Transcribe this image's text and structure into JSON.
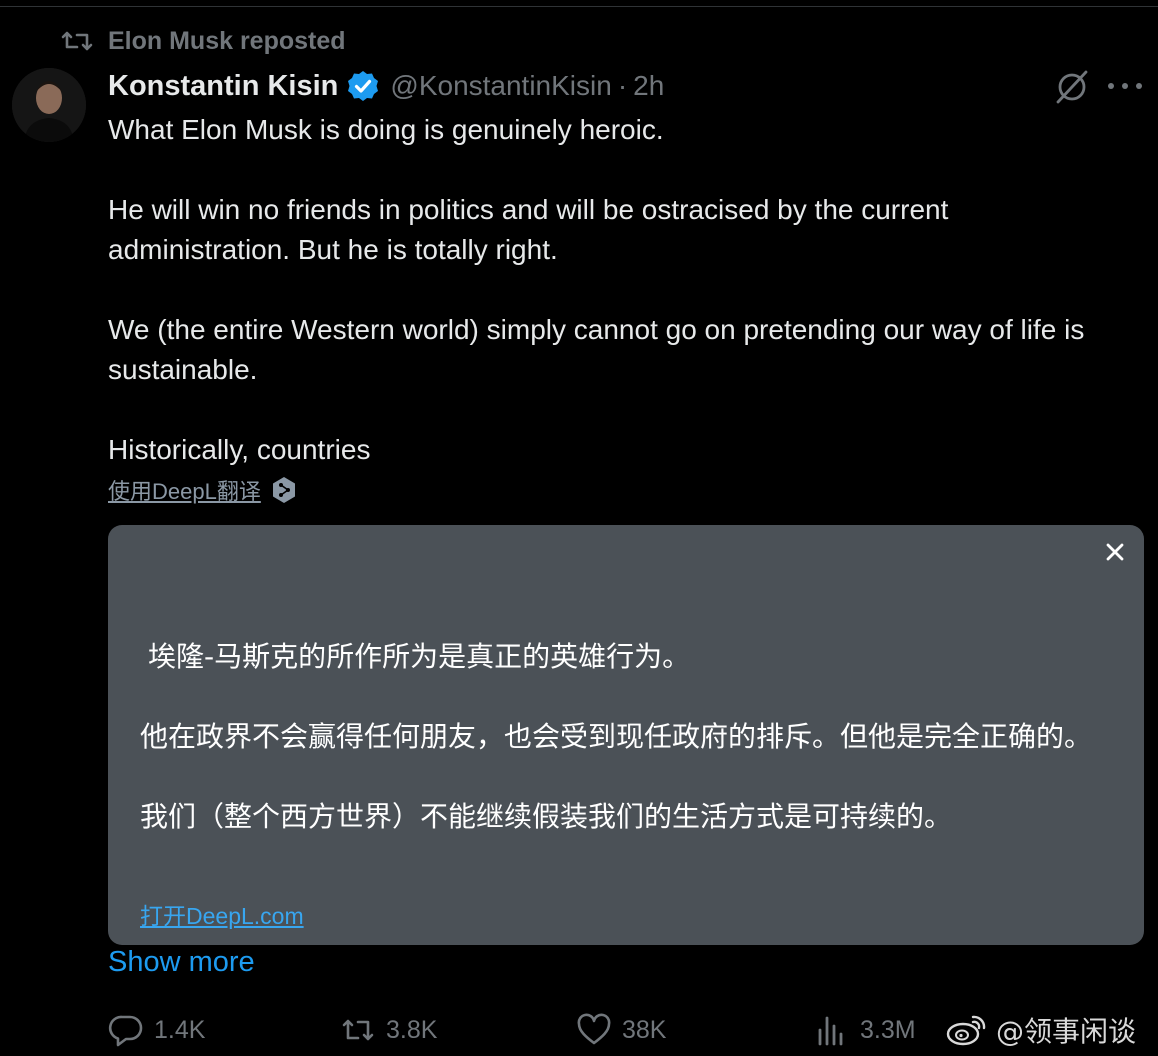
{
  "repost": {
    "label": "Elon Musk reposted",
    "icon": "repost-icon"
  },
  "author": {
    "display_name": "Konstantin Kisin",
    "verified_icon": "verified-badge-icon",
    "handle": "@KonstantinKisin",
    "separator": "·",
    "time": "2h"
  },
  "header_icons": {
    "grok": "grok-icon",
    "more": "more-icon"
  },
  "tweet": {
    "paragraphs": [
      "What Elon Musk is doing is genuinely heroic.",
      "He will win no friends in politics and will be ostracised by the current administration. But he is totally right.",
      "We (the entire Western world) simply cannot go on pretending our way of life is sustainable.",
      "Historically, countries"
    ]
  },
  "deepl": {
    "translate_link": "使用DeepL翻译",
    "badge_icon": "deepl-icon",
    "close_icon": "close-icon",
    "translation": [
      "埃隆-马斯克的所作所为是真正的英雄行为。",
      "他在政界不会赢得任何朋友，也会受到现任政府的排斥。但他是完全正确的。",
      "我们（整个西方世界）不能继续假装我们的生活方式是可持续的。"
    ],
    "open_link": "打开DeepL.com"
  },
  "show_more": "Show more",
  "actions": {
    "reply": {
      "icon": "reply-icon",
      "count": "1.4K"
    },
    "repost": {
      "icon": "repost-icon",
      "count": "3.8K"
    },
    "like": {
      "icon": "like-icon",
      "count": "38K"
    },
    "views": {
      "icon": "views-icon",
      "count": "3.3M"
    }
  },
  "watermark": {
    "icon": "weibo-icon",
    "text": "@领事闲谈"
  },
  "colors": {
    "background": "#000000",
    "text": "#e7e9ea",
    "muted": "#71767b",
    "accent": "#1d9bf0",
    "card": "#4b5157",
    "verified": "#1d9bf0"
  }
}
